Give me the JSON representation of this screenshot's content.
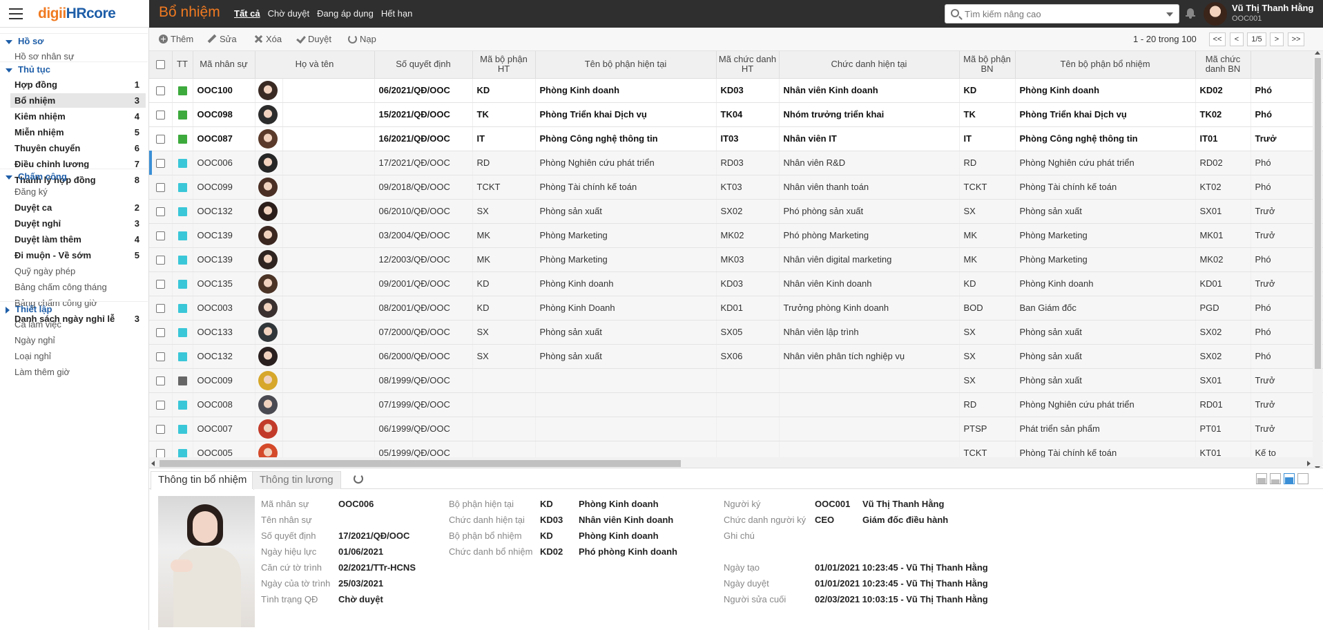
{
  "brand": {
    "part1": "digii",
    "part2": "HRcore"
  },
  "module_title": "Bổ nhiệm",
  "top_tabs": [
    "Tất cả",
    "Chờ duyệt",
    "Đang áp dụng",
    "Hết hạn"
  ],
  "search": {
    "placeholder": "Tìm kiếm nâng cao"
  },
  "user": {
    "name": "Vũ Thị Thanh Hằng",
    "code": "OOC001"
  },
  "sidebar": {
    "groups": [
      {
        "label": "Hồ sơ",
        "items": [
          {
            "label": "Hồ sơ nhân sự",
            "count": ""
          }
        ]
      },
      {
        "label": "Thủ tục",
        "items": [
          {
            "label": "Hợp đồng",
            "count": "1"
          },
          {
            "label": "Bổ nhiệm",
            "count": "3"
          },
          {
            "label": "Kiêm nhiệm",
            "count": "4"
          },
          {
            "label": "Miễn nhiệm",
            "count": "5"
          },
          {
            "label": "Thuyên chuyển",
            "count": "6"
          },
          {
            "label": "Điều chỉnh lương",
            "count": "7"
          },
          {
            "label": "Thanh lý hợp đồng",
            "count": "8"
          }
        ]
      },
      {
        "label": "Chấm công",
        "items": [
          {
            "label": "Đăng ký",
            "count": ""
          },
          {
            "label": "Duyệt ca",
            "count": "2"
          },
          {
            "label": "Duyệt nghỉ",
            "count": "3"
          },
          {
            "label": "Duyệt làm thêm",
            "count": "4"
          },
          {
            "label": "Đi muộn - Về sớm",
            "count": "5"
          },
          {
            "label": "Quỹ ngày phép",
            "count": ""
          },
          {
            "label": "Bảng chấm công tháng",
            "count": ""
          },
          {
            "label": "Bảng chấm công giờ",
            "count": ""
          },
          {
            "label": "Danh sách ngày nghỉ lễ",
            "count": "3"
          }
        ]
      },
      {
        "label": "Thiết lập",
        "items": [
          {
            "label": "Ca làm việc",
            "count": ""
          },
          {
            "label": "Ngày nghỉ",
            "count": ""
          },
          {
            "label": "Loại nghỉ",
            "count": ""
          },
          {
            "label": "Làm thêm giờ",
            "count": ""
          }
        ]
      }
    ]
  },
  "toolbar": {
    "add": "Thêm",
    "edit": "Sửa",
    "delete": "Xóa",
    "approve": "Duyệt",
    "reload": "Nạp",
    "page_info": "1 - 20 trong 100",
    "first": "<<",
    "prev": "<",
    "page": "1/5",
    "next": ">",
    "last": ">>"
  },
  "grid": {
    "headers": [
      "TT",
      "Mã nhân sự",
      "Họ và tên",
      "Số quyết định",
      "Mã bộ phận HT",
      "Tên bộ phận hiện tại",
      "Mã chức danh HT",
      "Chức danh hiện tại",
      "Mã bộ phận BN",
      "Tên bộ phận bổ nhiệm",
      "Mã chức danh BN"
    ],
    "status_colors": {
      "green": "#3daa3d",
      "cyan": "#3ac7d8",
      "gray": "#666666"
    },
    "rows": [
      {
        "status": "green",
        "code": "OOC100",
        "name": "",
        "decision": "06/2021/QĐ/OOC",
        "dept_ht": "KD",
        "dept_ht_name": "Phòng Kinh doanh",
        "title_ht": "KD03",
        "title_ht_name": "Nhân viên Kinh doanh",
        "dept_bn": "KD",
        "dept_bn_name": "Phòng Kinh doanh",
        "title_bn": "KD02",
        "title_bn_name": "Phó",
        "bold": true
      },
      {
        "status": "green",
        "code": "OOC098",
        "name": "",
        "decision": "15/2021/QĐ/OOC",
        "dept_ht": "TK",
        "dept_ht_name": "Phòng Triển khai Dịch vụ",
        "title_ht": "TK04",
        "title_ht_name": "Nhóm trưởng triển khai",
        "dept_bn": "TK",
        "dept_bn_name": "Phòng Triển khai Dịch vụ",
        "title_bn": "TK02",
        "title_bn_name": "Phó",
        "bold": true
      },
      {
        "status": "green",
        "code": "OOC087",
        "name": "",
        "decision": "16/2021/QĐ/OOC",
        "dept_ht": "IT",
        "dept_ht_name": "Phòng Công nghệ thông tin",
        "title_ht": "IT03",
        "title_ht_name": "Nhân viên IT",
        "dept_bn": "IT",
        "dept_bn_name": "Phòng Công nghệ thông tin",
        "title_bn": "IT01",
        "title_bn_name": "Trưở",
        "bold": true
      },
      {
        "status": "cyan",
        "code": "OOC006",
        "name": "",
        "decision": "17/2021/QĐ/OOC",
        "dept_ht": "RD",
        "dept_ht_name": "Phòng Nghiên cứu phát triển",
        "title_ht": "RD03",
        "title_ht_name": "Nhân viên R&D",
        "dept_bn": "RD",
        "dept_bn_name": "Phòng Nghiên cứu phát triển",
        "title_bn": "RD02",
        "title_bn_name": "Phó",
        "bold": false,
        "selected": true
      },
      {
        "status": "cyan",
        "code": "OOC099",
        "name": "",
        "decision": "09/2018/QĐ/OOC",
        "dept_ht": "TCKT",
        "dept_ht_name": "Phòng Tài chính kế toán",
        "title_ht": "KT03",
        "title_ht_name": "Nhân viên thanh toán",
        "dept_bn": "TCKT",
        "dept_bn_name": "Phòng Tài chính kế toán",
        "title_bn": "KT02",
        "title_bn_name": "Phó",
        "bold": false
      },
      {
        "status": "cyan",
        "code": "OOC132",
        "name": "",
        "decision": "06/2010/QĐ/OOC",
        "dept_ht": "SX",
        "dept_ht_name": "Phòng sản xuất",
        "title_ht": "SX02",
        "title_ht_name": "Phó phòng sản xuất",
        "dept_bn": "SX",
        "dept_bn_name": "Phòng sản xuất",
        "title_bn": "SX01",
        "title_bn_name": "Trưở",
        "bold": false
      },
      {
        "status": "cyan",
        "code": "OOC139",
        "name": "",
        "decision": "03/2004/QĐ/OOC",
        "dept_ht": "MK",
        "dept_ht_name": "Phòng Marketing",
        "title_ht": "MK02",
        "title_ht_name": "Phó phòng Marketing",
        "dept_bn": "MK",
        "dept_bn_name": "Phòng Marketing",
        "title_bn": "MK01",
        "title_bn_name": "Trưở",
        "bold": false
      },
      {
        "status": "cyan",
        "code": "OOC139",
        "name": "",
        "decision": "12/2003/QĐ/OOC",
        "dept_ht": "MK",
        "dept_ht_name": "Phòng Marketing",
        "title_ht": "MK03",
        "title_ht_name": "Nhân viên digital marketing",
        "dept_bn": "MK",
        "dept_bn_name": "Phòng Marketing",
        "title_bn": "MK02",
        "title_bn_name": "Phó",
        "bold": false
      },
      {
        "status": "cyan",
        "code": "OOC135",
        "name": "",
        "decision": "09/2001/QĐ/OOC",
        "dept_ht": "KD",
        "dept_ht_name": "Phòng Kinh doanh",
        "title_ht": "KD03",
        "title_ht_name": "Nhân viên Kinh doanh",
        "dept_bn": "KD",
        "dept_bn_name": "Phòng Kinh doanh",
        "title_bn": "KD01",
        "title_bn_name": "Trưở",
        "bold": false
      },
      {
        "status": "cyan",
        "code": "OOC003",
        "name": "",
        "decision": "08/2001/QĐ/OOC",
        "dept_ht": "KD",
        "dept_ht_name": "Phòng Kinh Doanh",
        "title_ht": "KD01",
        "title_ht_name": "Trưởng phòng Kinh doanh",
        "dept_bn": "BOD",
        "dept_bn_name": "Ban Giám đốc",
        "title_bn": "PGD",
        "title_bn_name": "Phó",
        "bold": false
      },
      {
        "status": "cyan",
        "code": "OOC133",
        "name": "",
        "decision": "07/2000/QĐ/OOC",
        "dept_ht": "SX",
        "dept_ht_name": "Phòng sản xuất",
        "title_ht": "SX05",
        "title_ht_name": "Nhân viên lập trình",
        "dept_bn": "SX",
        "dept_bn_name": "Phòng sản xuất",
        "title_bn": "SX02",
        "title_bn_name": "Phó",
        "bold": false
      },
      {
        "status": "cyan",
        "code": "OOC132",
        "name": "",
        "decision": "06/2000/QĐ/OOC",
        "dept_ht": "SX",
        "dept_ht_name": "Phòng sản xuất",
        "title_ht": "SX06",
        "title_ht_name": "Nhân viên phân tích nghiệp vụ",
        "dept_bn": "SX",
        "dept_bn_name": "Phòng sản xuất",
        "title_bn": "SX02",
        "title_bn_name": "Phó",
        "bold": false
      },
      {
        "status": "gray",
        "code": "OOC009",
        "name": "",
        "decision": "08/1999/QĐ/OOC",
        "dept_ht": "",
        "dept_ht_name": "",
        "title_ht": "",
        "title_ht_name": "",
        "dept_bn": "SX",
        "dept_bn_name": "Phòng sản xuất",
        "title_bn": "SX01",
        "title_bn_name": "Trưở",
        "bold": false
      },
      {
        "status": "cyan",
        "code": "OOC008",
        "name": "",
        "decision": "07/1999/QĐ/OOC",
        "dept_ht": "",
        "dept_ht_name": "",
        "title_ht": "",
        "title_ht_name": "",
        "dept_bn": "RD",
        "dept_bn_name": "Phòng Nghiên cứu phát triển",
        "title_bn": "RD01",
        "title_bn_name": "Trưở",
        "bold": false
      },
      {
        "status": "cyan",
        "code": "OOC007",
        "name": "",
        "decision": "06/1999/QĐ/OOC",
        "dept_ht": "",
        "dept_ht_name": "",
        "title_ht": "",
        "title_ht_name": "",
        "dept_bn": "PTSP",
        "dept_bn_name": "Phát triển sản phẩm",
        "title_bn": "PT01",
        "title_bn_name": "Trưở",
        "bold": false
      },
      {
        "status": "cyan",
        "code": "OOC005",
        "name": "",
        "decision": "05/1999/QĐ/OOC",
        "dept_ht": "",
        "dept_ht_name": "",
        "title_ht": "",
        "title_ht_name": "",
        "dept_bn": "TCKT",
        "dept_bn_name": "Phòng Tài chính kế toán",
        "title_bn": "KT01",
        "title_bn_name": "Kế to",
        "bold": false
      }
    ]
  },
  "detail": {
    "tabs": [
      "Thông tin bổ nhiệm",
      "Thông tin lương"
    ],
    "labels": {
      "code": "Mã nhân sự",
      "name": "Tên nhân sự",
      "decision": "Số quyết định",
      "effective": "Ngày hiệu lực",
      "basis": "Căn cứ tờ trình",
      "basis_date": "Ngày của tờ trình",
      "status": "Tình trạng QĐ",
      "dept_cur": "Bộ phận hiện tại",
      "title_cur": "Chức danh hiện tại",
      "dept_new": "Bộ phận bổ nhiệm",
      "title_new": "Chức danh bổ nhiệm",
      "signer": "Người ký",
      "signer_title": "Chức danh người ký",
      "note": "Ghi chú",
      "created": "Ngày tạo",
      "approved": "Ngày duyệt",
      "modified": "Người sửa cuối"
    },
    "values": {
      "code": "OOC006",
      "name": "",
      "decision": "17/2021/QĐ/OOC",
      "effective": "01/06/2021",
      "basis": "02/2021/TTr-HCNS",
      "basis_date": "25/03/2021",
      "status": "Chờ duyệt",
      "dept_cur_code": "KD",
      "dept_cur_name": "Phòng Kinh doanh",
      "title_cur_code": "KD03",
      "title_cur_name": "Nhân viên Kinh doanh",
      "dept_new_code": "KD",
      "dept_new_name": "Phòng Kinh doanh",
      "title_new_code": "KD02",
      "title_new_name": "Phó phòng Kinh doanh",
      "signer_code": "OOC001",
      "signer_name": "Vũ Thị Thanh Hằng",
      "signer_title_code": "CEO",
      "signer_title_name": "Giám đốc điều hành",
      "note": "",
      "created": "01/01/2021 10:23:45 - Vũ Thị Thanh Hằng",
      "approved": "01/01/2021 10:23:45 - Vũ Thị Thanh Hằng",
      "modified": "02/03/2021 10:03:15 - Vũ Thị Thanh Hằng"
    }
  }
}
